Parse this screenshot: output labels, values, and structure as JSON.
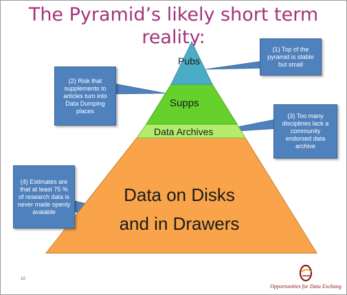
{
  "title": {
    "line1": "The Pyramid’s likely short term",
    "line2": "reality:"
  },
  "pyramid": {
    "layers": [
      {
        "id": "pubs",
        "label": "Pubs",
        "color": "#4bacc6"
      },
      {
        "id": "supps",
        "label": "Supps",
        "color": "#66d12c"
      },
      {
        "id": "archives",
        "label": "Data Archives",
        "color": "#b4ec6c"
      },
      {
        "id": "disks",
        "label_line1": "Data on Disks",
        "label_line2": "and in Drawers",
        "color": "#f9a44a"
      }
    ]
  },
  "callouts": [
    {
      "text": "(1) Top of the pyramid is stable but small"
    },
    {
      "text": "(2) Risk that supplements to articles turn into Data Dumping places"
    },
    {
      "text": "(3) Too many disciplines lack a community endorsed data archive"
    },
    {
      "text": "(4) Estimates are that at least 75 % of research data is never made openly avaiable"
    }
  ],
  "footer": {
    "page_number": "10",
    "logo_text": "Opportunities for Data Exchang"
  },
  "colors": {
    "title": "#a4327a",
    "callout_fill": "#4f81bd",
    "logo": "#8b1a1a"
  },
  "icons": [
    "ode-logo-icon"
  ]
}
